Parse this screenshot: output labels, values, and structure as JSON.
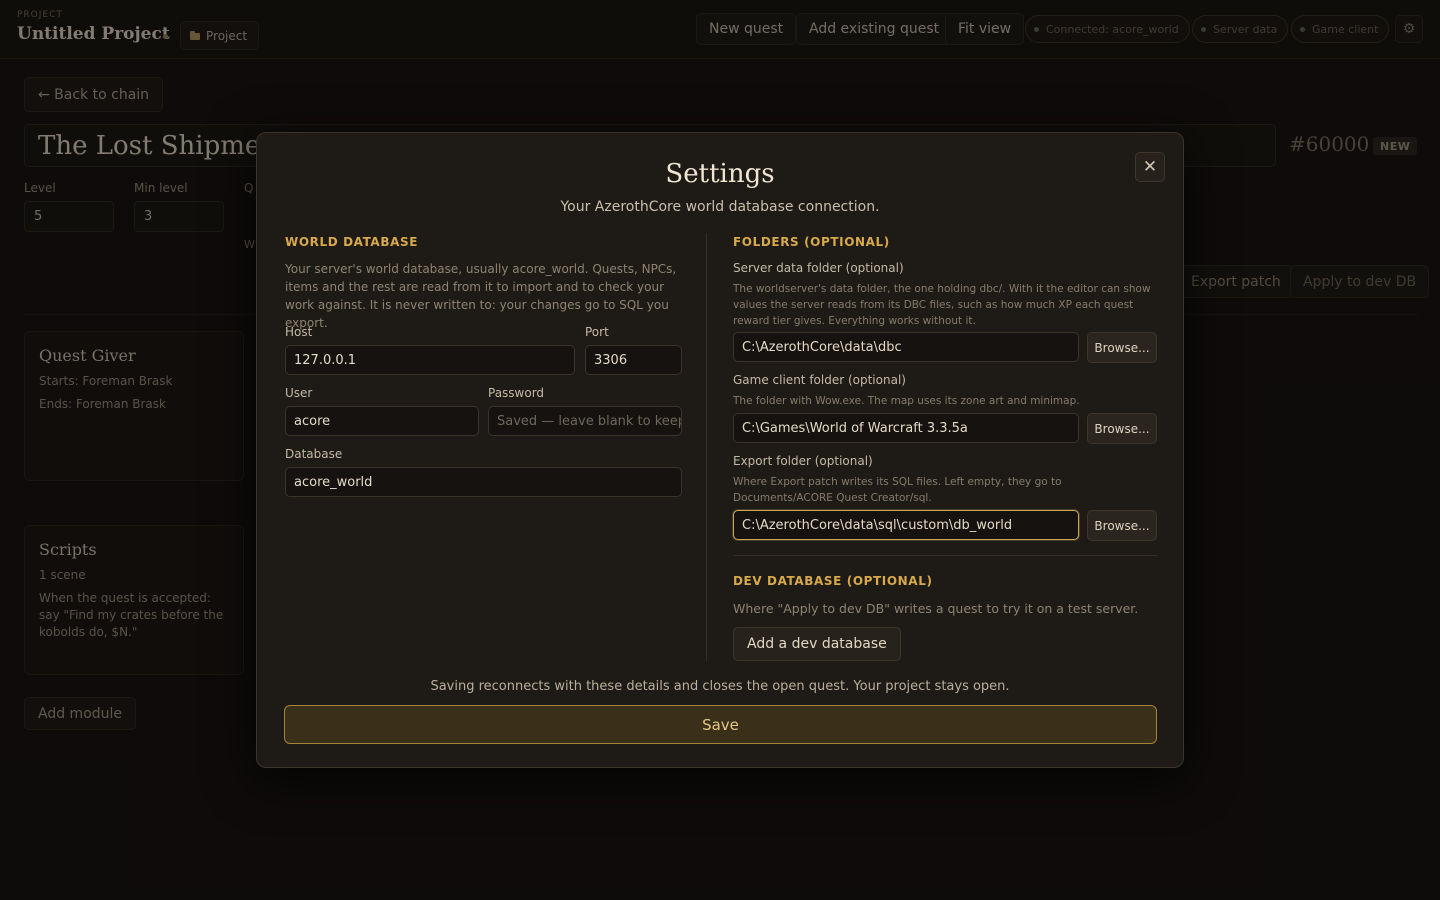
{
  "topbar": {
    "project_label": "PROJECT",
    "project_title": "Untitled Project",
    "project_chip": "Project",
    "buttons": {
      "new_quest": "New quest",
      "add_existing": "Add existing quest",
      "fit_view": "Fit view"
    },
    "pills": {
      "connected": "Connected: acore_world",
      "server_data": "Server data",
      "game_client": "Game client"
    },
    "gear_icon": "⚙"
  },
  "editor": {
    "back_label": "← Back to chain",
    "quest_title": "The Lost Shipment",
    "quest_id": "#60000",
    "badge": "NEW",
    "fields": {
      "level_label": "Level",
      "level_value": "5",
      "min_level_label": "Min level",
      "min_level_value": "3",
      "partial_label": "Q",
      "partial_hint": "W"
    },
    "export_patch": "Export patch",
    "apply_dev": "Apply to dev DB",
    "quest_giver": {
      "title": "Quest Giver",
      "starts": "Starts: Foreman Brask",
      "ends": "Ends: Foreman Brask"
    },
    "scripts": {
      "title": "Scripts",
      "count": "1 scene",
      "summary": "When the quest is accepted: say \"Find my crates before the kobolds do, $N.\""
    },
    "add_module": "Add module"
  },
  "settings": {
    "title": "Settings",
    "subtitle": "Your AzerothCore world database connection.",
    "close_icon": "✕",
    "world_db": {
      "heading": "WORLD DATABASE",
      "description": "Your server's world database, usually acore_world. Quests, NPCs, items and the rest are read from it to import and to check your work against. It is never written to: your changes go to SQL you export.",
      "host_label": "Host",
      "host_value": "127.0.0.1",
      "port_label": "Port",
      "port_value": "3306",
      "user_label": "User",
      "user_value": "acore",
      "password_label": "Password",
      "password_placeholder": "Saved — leave blank to keep",
      "database_label": "Database",
      "database_value": "acore_world"
    },
    "folders": {
      "heading": "FOLDERS (OPTIONAL)",
      "server_label": "Server data folder (optional)",
      "server_desc": "The worldserver's data folder, the one holding dbc/. With it the editor can show values the server reads from its DBC files, such as how much XP each quest reward tier gives. Everything works without it.",
      "server_value": "C:\\AzerothCore\\data\\dbc",
      "client_label": "Game client folder (optional)",
      "client_desc": "The folder with Wow.exe. The map uses its zone art and minimap.",
      "client_value": "C:\\Games\\World of Warcraft 3.3.5a",
      "export_label": "Export folder (optional)",
      "export_desc": "Where Export patch writes its SQL files. Left empty, they go to Documents/ACORE Quest Creator/sql.",
      "export_value": "C:\\AzerothCore\\data\\sql\\custom\\db_world",
      "browse": "Browse..."
    },
    "dev_db": {
      "heading": "DEV DATABASE (OPTIONAL)",
      "description": "Where \"Apply to dev DB\" writes a quest to try it on a test server.",
      "add_button": "Add a dev database"
    },
    "footer_note": "Saving reconnects with these details and closes the open quest. Your project stays open.",
    "save": "Save"
  }
}
